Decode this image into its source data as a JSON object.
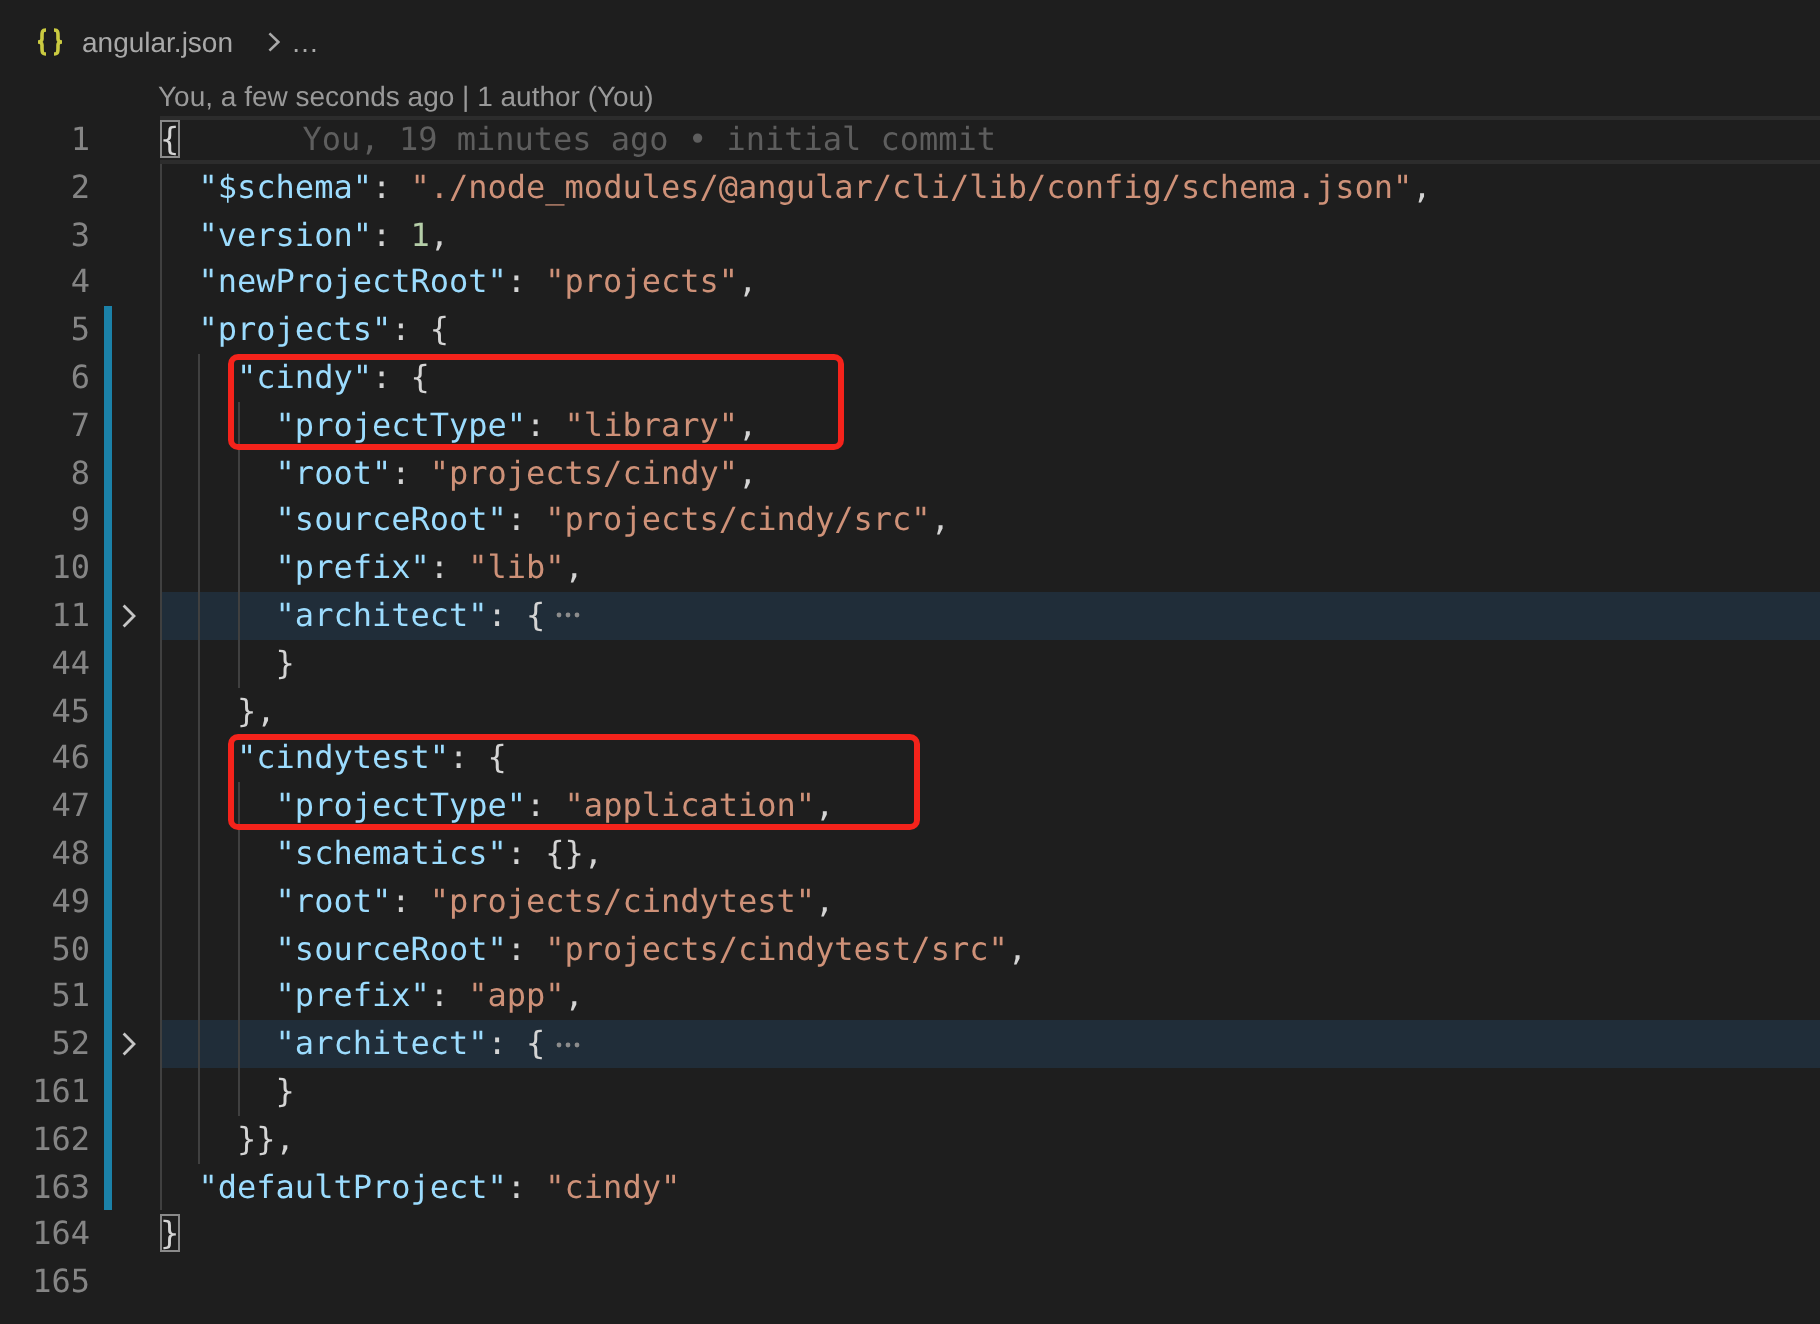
{
  "breadcrumb": {
    "file": "angular.json",
    "more": "…"
  },
  "codelens": "You, a few seconds ago | 1 author (You)",
  "lines": [
    {
      "number": "1",
      "current": true,
      "modified": false,
      "folded": false,
      "framed": false,
      "tokens": [
        {
          "kind": "match",
          "text": "{"
        }
      ],
      "blame": "You, 19 minutes ago • initial commit",
      "children": [
        {
          "number": "2",
          "current": false,
          "modified": false,
          "folded": false,
          "framed": false,
          "tokens": [
            {
              "kind": "key",
              "text": "\"$schema\""
            },
            {
              "kind": "punct",
              "text": ": "
            },
            {
              "kind": "string",
              "text": "\"./node_modules/@angular/cli/lib/config/schema.json\""
            },
            {
              "kind": "punct",
              "text": ","
            }
          ]
        },
        {
          "number": "3",
          "current": false,
          "modified": false,
          "folded": false,
          "framed": false,
          "tokens": [
            {
              "kind": "key",
              "text": "\"version\""
            },
            {
              "kind": "punct",
              "text": ": "
            },
            {
              "kind": "number",
              "text": "1"
            },
            {
              "kind": "punct",
              "text": ","
            }
          ]
        },
        {
          "number": "4",
          "current": false,
          "modified": false,
          "folded": false,
          "framed": false,
          "tokens": [
            {
              "kind": "key",
              "text": "\"newProjectRoot\""
            },
            {
              "kind": "punct",
              "text": ": "
            },
            {
              "kind": "string",
              "text": "\"projects\""
            },
            {
              "kind": "punct",
              "text": ","
            }
          ]
        },
        {
          "number": "5",
          "current": false,
          "modified": true,
          "folded": false,
          "framed": false,
          "tokens": [
            {
              "kind": "key",
              "text": "\"projects\""
            },
            {
              "kind": "punct",
              "text": ": {"
            }
          ],
          "children": [
            {
              "number": "6",
              "current": false,
              "modified": true,
              "folded": false,
              "framed": true,
              "tokens": [
                {
                  "kind": "key",
                  "text": "\"cindy\""
                },
                {
                  "kind": "punct",
                  "text": ": {"
                }
              ],
              "children": [
                {
                  "number": "7",
                  "current": false,
                  "modified": true,
                  "folded": false,
                  "framed": true,
                  "tokens": [
                    {
                      "kind": "key",
                      "text": "\"projectType\""
                    },
                    {
                      "kind": "punct",
                      "text": ": "
                    },
                    {
                      "kind": "string",
                      "text": "\"library\""
                    },
                    {
                      "kind": "punct",
                      "text": ","
                    }
                  ]
                },
                {
                  "number": "8",
                  "current": false,
                  "modified": true,
                  "folded": false,
                  "framed": false,
                  "tokens": [
                    {
                      "kind": "key",
                      "text": "\"root\""
                    },
                    {
                      "kind": "punct",
                      "text": ": "
                    },
                    {
                      "kind": "string",
                      "text": "\"projects/cindy\""
                    },
                    {
                      "kind": "punct",
                      "text": ","
                    }
                  ]
                },
                {
                  "number": "9",
                  "current": false,
                  "modified": true,
                  "folded": false,
                  "framed": false,
                  "tokens": [
                    {
                      "kind": "key",
                      "text": "\"sourceRoot\""
                    },
                    {
                      "kind": "punct",
                      "text": ": "
                    },
                    {
                      "kind": "string",
                      "text": "\"projects/cindy/src\""
                    },
                    {
                      "kind": "punct",
                      "text": ","
                    }
                  ]
                },
                {
                  "number": "10",
                  "current": false,
                  "modified": true,
                  "folded": false,
                  "framed": false,
                  "tokens": [
                    {
                      "kind": "key",
                      "text": "\"prefix\""
                    },
                    {
                      "kind": "punct",
                      "text": ": "
                    },
                    {
                      "kind": "string",
                      "text": "\"lib\""
                    },
                    {
                      "kind": "punct",
                      "text": ","
                    }
                  ]
                },
                {
                  "number": "11",
                  "current": false,
                  "modified": true,
                  "folded": true,
                  "framed": false,
                  "tokens": [
                    {
                      "kind": "key",
                      "text": "\"architect\""
                    },
                    {
                      "kind": "punct",
                      "text": ": {"
                    }
                  ]
                },
                {
                  "number": "44",
                  "current": false,
                  "modified": true,
                  "folded": false,
                  "framed": false,
                  "tokens": [
                    {
                      "kind": "punct",
                      "text": "}"
                    }
                  ]
                }
              ]
            },
            {
              "number": "45",
              "current": false,
              "modified": true,
              "folded": false,
              "framed": false,
              "tokens": [
                {
                  "kind": "punct",
                  "text": "},"
                }
              ]
            },
            {
              "number": "46",
              "current": false,
              "modified": true,
              "folded": false,
              "framed": true,
              "tokens": [
                {
                  "kind": "key",
                  "text": "\"cindytest\""
                },
                {
                  "kind": "punct",
                  "text": ": {"
                }
              ],
              "children": [
                {
                  "number": "47",
                  "current": false,
                  "modified": true,
                  "folded": false,
                  "framed": true,
                  "tokens": [
                    {
                      "kind": "key",
                      "text": "\"projectType\""
                    },
                    {
                      "kind": "punct",
                      "text": ": "
                    },
                    {
                      "kind": "string",
                      "text": "\"application\""
                    },
                    {
                      "kind": "punct",
                      "text": ","
                    }
                  ]
                },
                {
                  "number": "48",
                  "current": false,
                  "modified": true,
                  "folded": false,
                  "framed": false,
                  "tokens": [
                    {
                      "kind": "key",
                      "text": "\"schematics\""
                    },
                    {
                      "kind": "punct",
                      "text": ": {},"
                    }
                  ]
                },
                {
                  "number": "49",
                  "current": false,
                  "modified": true,
                  "folded": false,
                  "framed": false,
                  "tokens": [
                    {
                      "kind": "key",
                      "text": "\"root\""
                    },
                    {
                      "kind": "punct",
                      "text": ": "
                    },
                    {
                      "kind": "string",
                      "text": "\"projects/cindytest\""
                    },
                    {
                      "kind": "punct",
                      "text": ","
                    }
                  ]
                },
                {
                  "number": "50",
                  "current": false,
                  "modified": true,
                  "folded": false,
                  "framed": false,
                  "tokens": [
                    {
                      "kind": "key",
                      "text": "\"sourceRoot\""
                    },
                    {
                      "kind": "punct",
                      "text": ": "
                    },
                    {
                      "kind": "string",
                      "text": "\"projects/cindytest/src\""
                    },
                    {
                      "kind": "punct",
                      "text": ","
                    }
                  ]
                },
                {
                  "number": "51",
                  "current": false,
                  "modified": true,
                  "folded": false,
                  "framed": false,
                  "tokens": [
                    {
                      "kind": "key",
                      "text": "\"prefix\""
                    },
                    {
                      "kind": "punct",
                      "text": ": "
                    },
                    {
                      "kind": "string",
                      "text": "\"app\""
                    },
                    {
                      "kind": "punct",
                      "text": ","
                    }
                  ]
                },
                {
                  "number": "52",
                  "current": false,
                  "modified": true,
                  "folded": true,
                  "framed": false,
                  "tokens": [
                    {
                      "kind": "key",
                      "text": "\"architect\""
                    },
                    {
                      "kind": "punct",
                      "text": ": {"
                    }
                  ]
                },
                {
                  "number": "161",
                  "current": false,
                  "modified": true,
                  "folded": false,
                  "framed": false,
                  "tokens": [
                    {
                      "kind": "punct",
                      "text": "}"
                    }
                  ]
                }
              ]
            },
            {
              "number": "162",
              "current": false,
              "modified": true,
              "folded": false,
              "framed": false,
              "tokens": [
                {
                  "kind": "punct",
                  "text": "}},"
                }
              ]
            }
          ]
        },
        {
          "number": "163",
          "current": false,
          "modified": true,
          "folded": false,
          "framed": false,
          "tokens": [
            {
              "kind": "key",
              "text": "\"defaultProject\""
            },
            {
              "kind": "punct",
              "text": ": "
            },
            {
              "kind": "string",
              "text": "\"cindy\""
            }
          ]
        }
      ]
    },
    {
      "number": "164",
      "current": false,
      "modified": false,
      "folded": false,
      "framed": false,
      "tokens": [
        {
          "kind": "match",
          "text": "}"
        }
      ]
    },
    {
      "number": "165",
      "current": false,
      "modified": false,
      "folded": false,
      "framed": false
    }
  ]
}
